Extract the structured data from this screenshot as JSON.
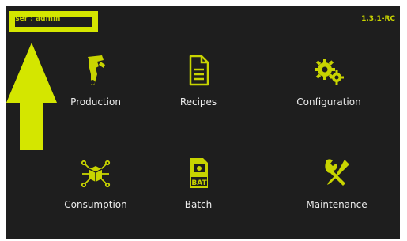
{
  "header": {
    "user_label": "User : admin",
    "version": "1.3.1-RC"
  },
  "menu": [
    {
      "label": "Production",
      "icon": "spray-gun-icon"
    },
    {
      "label": "Recipes",
      "icon": "document-icon"
    },
    {
      "label": "Configuration",
      "icon": "gears-icon"
    },
    {
      "label": "Consumption",
      "icon": "box-network-icon"
    },
    {
      "label": "Batch",
      "icon": "batch-file-icon"
    },
    {
      "label": "Maintenance",
      "icon": "tools-icon"
    }
  ],
  "colors": {
    "background": "#1e1e1e",
    "accent": "#c8d400",
    "highlight": "#d4e600",
    "label": "#ececec"
  }
}
